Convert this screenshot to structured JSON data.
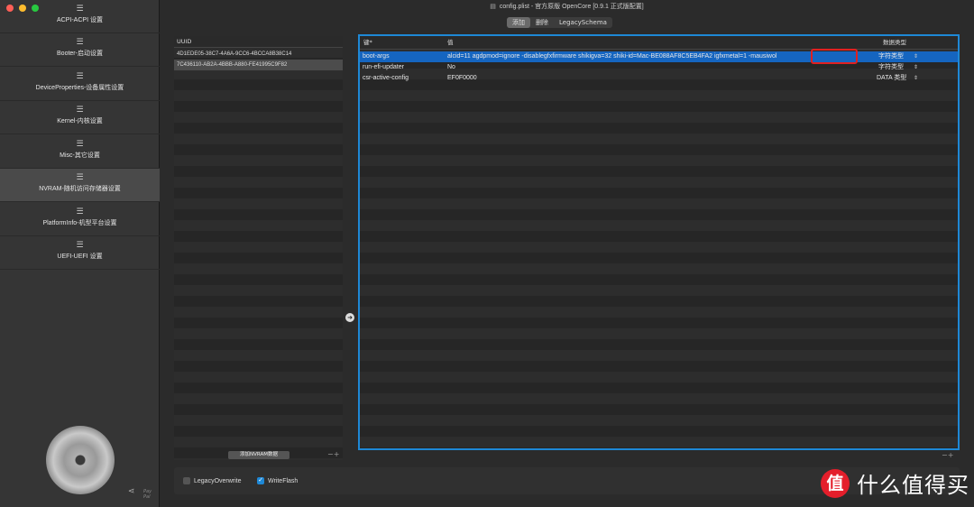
{
  "window": {
    "title": "config.plist - 官方原版 OpenCore [0.9.1 正式版配置]"
  },
  "sidebar": {
    "items": [
      {
        "label": "ACPI-ACPI 设置"
      },
      {
        "label": "Booter-启动设置"
      },
      {
        "label": "DeviceProperties-设备属性设置"
      },
      {
        "label": "Kernel-内核设置"
      },
      {
        "label": "Misc-其它设置"
      },
      {
        "label": "NVRAM-随机访问存储器设置",
        "selected": true
      },
      {
        "label": "PlatformInfo-机型平台设置"
      },
      {
        "label": "UEFI-UEFI 设置"
      }
    ],
    "paypal": "Pay Pal"
  },
  "tabs": [
    {
      "label": "添加",
      "active": true
    },
    {
      "label": "删除"
    },
    {
      "label": "LegacySchema"
    }
  ],
  "uuid_list": {
    "header": "UUID",
    "rows": [
      "4D1EDE05-38C7-4A6A-9CC6-4BCCA8B38C14",
      "7C436110-AB2A-4BBB-A880-FE41995C9F82"
    ],
    "selected_index": 1,
    "add_button": "添加NVRAM数据"
  },
  "table": {
    "headers": {
      "key": "键*",
      "value": "值",
      "type": "数据类型"
    },
    "rows": [
      {
        "key": "boot-args",
        "value": "alcid=11 agdpmod=ignore -disablegfxfirmware shikigva=32 shiki-id=Mac-BE088AF8C5EB4FA2 igfxmetal=1 -mausiwol",
        "type": "字符类型",
        "selected": true
      },
      {
        "key": "run-efi-updater",
        "value": "No",
        "type": "字符类型"
      },
      {
        "key": "csr-active-config",
        "value": "EF0F0000",
        "type": "DATA 类型"
      }
    ]
  },
  "options": {
    "legacy_overwrite": {
      "label": "LegacyOverwrite",
      "checked": false
    },
    "write_flash": {
      "label": "WriteFlash",
      "checked": true
    }
  },
  "watermark": {
    "icon": "值",
    "text": "什么值得买"
  },
  "colors": {
    "selection": "#1565c0",
    "focus_border": "#1e88d6",
    "highlight_box": "#e02020",
    "logo": "#e41e2b"
  }
}
